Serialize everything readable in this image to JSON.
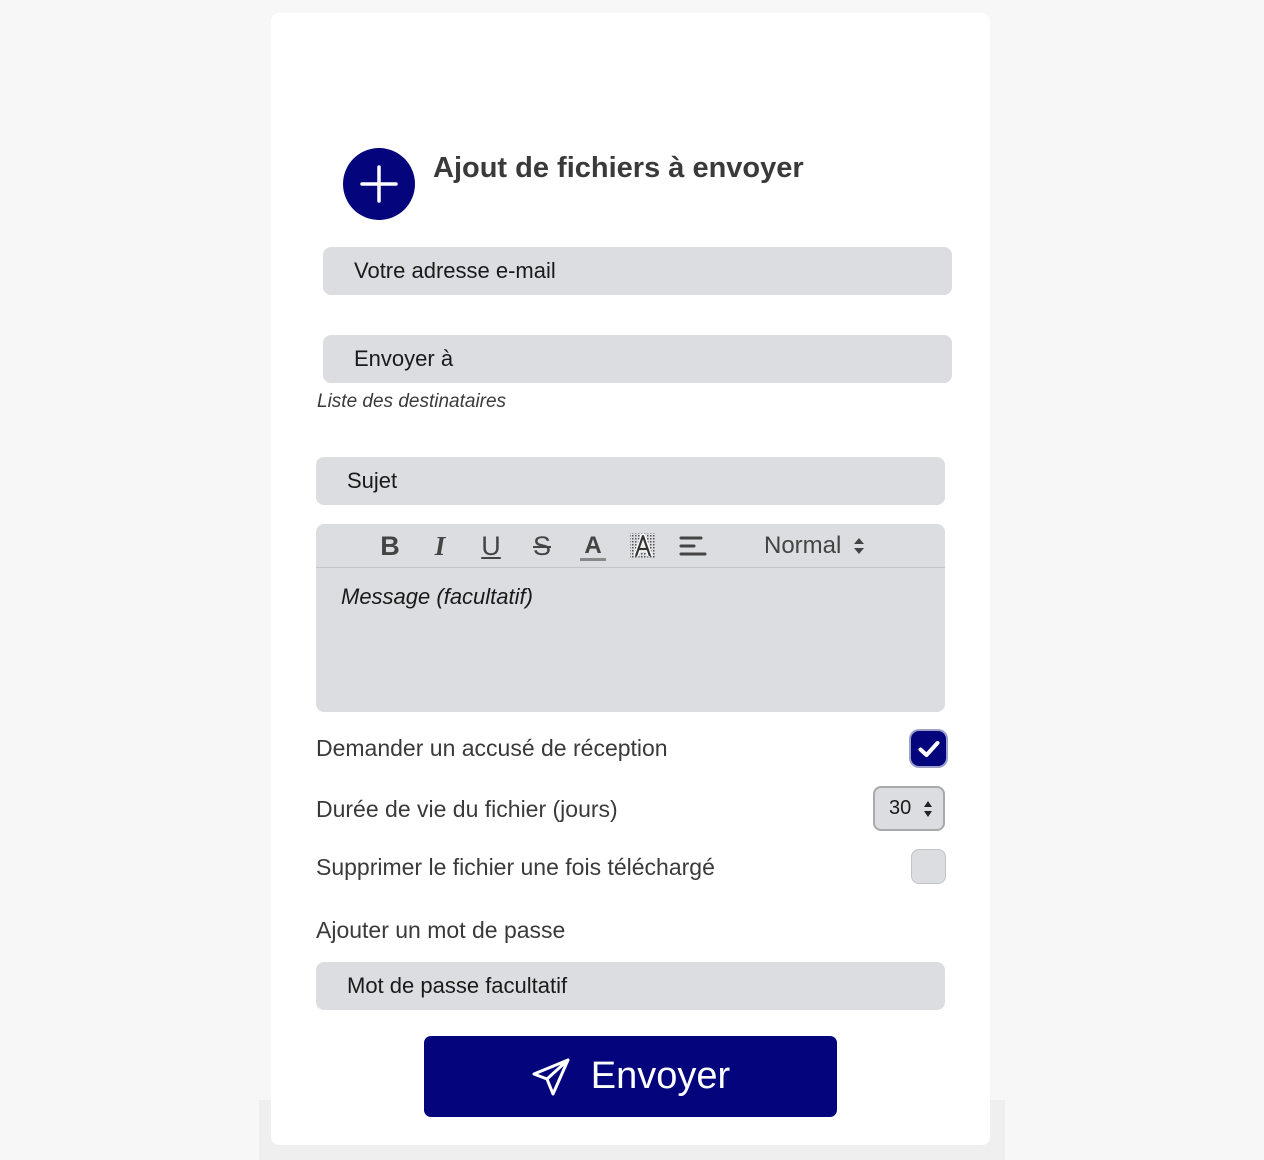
{
  "header": {
    "title": "Ajout de fichiers à envoyer"
  },
  "form": {
    "email_placeholder": "Votre adresse e-mail",
    "recipients_placeholder": "Envoyer à",
    "recipients_hint": "Liste des destinataires",
    "subject_placeholder": "Sujet",
    "message_placeholder": "Message (facultatif)",
    "password_placeholder": "Mot de passe facultatif"
  },
  "toolbar": {
    "bold": "B",
    "italic": "I",
    "underline": "U",
    "strike": "S",
    "color": "A",
    "background": "A",
    "size_value": "Normal"
  },
  "options": {
    "receipt_label": "Demander un accusé de réception",
    "receipt_checked": true,
    "lifetime_label": "Durée de vie du fichier (jours)",
    "lifetime_value": "30",
    "delete_label": "Supprimer le fichier une fois téléchargé",
    "delete_checked": false,
    "password_label": "Ajouter un mot de passe"
  },
  "actions": {
    "send_label": "Envoyer"
  },
  "colors": {
    "accent": "#04047c",
    "field_bg": "#dcdde0"
  }
}
